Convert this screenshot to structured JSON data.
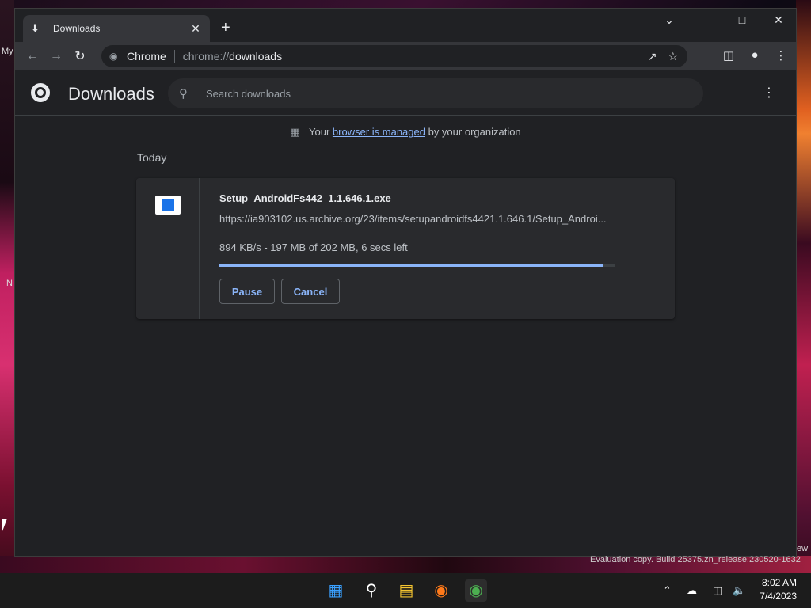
{
  "desktop": {
    "label_my": "My",
    "label_n": "N",
    "label_ew": "ew"
  },
  "tab": {
    "title": "Downloads",
    "icon": "download-icon"
  },
  "omnibox": {
    "site": "Chrome",
    "url_prefix": "chrome://",
    "url_path": "downloads"
  },
  "page": {
    "title": "Downloads",
    "search_placeholder": "Search downloads",
    "managed_prefix": "Your",
    "managed_link": "browser is managed",
    "managed_suffix": "by your organization",
    "date_group": "Today"
  },
  "download": {
    "file_name": "Setup_AndroidFs442_1.1.646.1.exe",
    "url": "https://ia903102.us.archive.org/23/items/setupandroidfs4421.1.646.1/Setup_Androi...",
    "status": "894 KB/s - 197 MB of 202 MB, 6 secs left",
    "progress": 0.97,
    "pause_label": "Pause",
    "cancel_label": "Cancel"
  },
  "watermark": "Evaluation copy. Build 25375.zn_release.230520-1632",
  "clock": {
    "time": "8:02 AM",
    "date": "7/4/2023"
  },
  "colors": {
    "accent": "#8ab4f8",
    "background": "#202124",
    "card": "#292a2d"
  }
}
